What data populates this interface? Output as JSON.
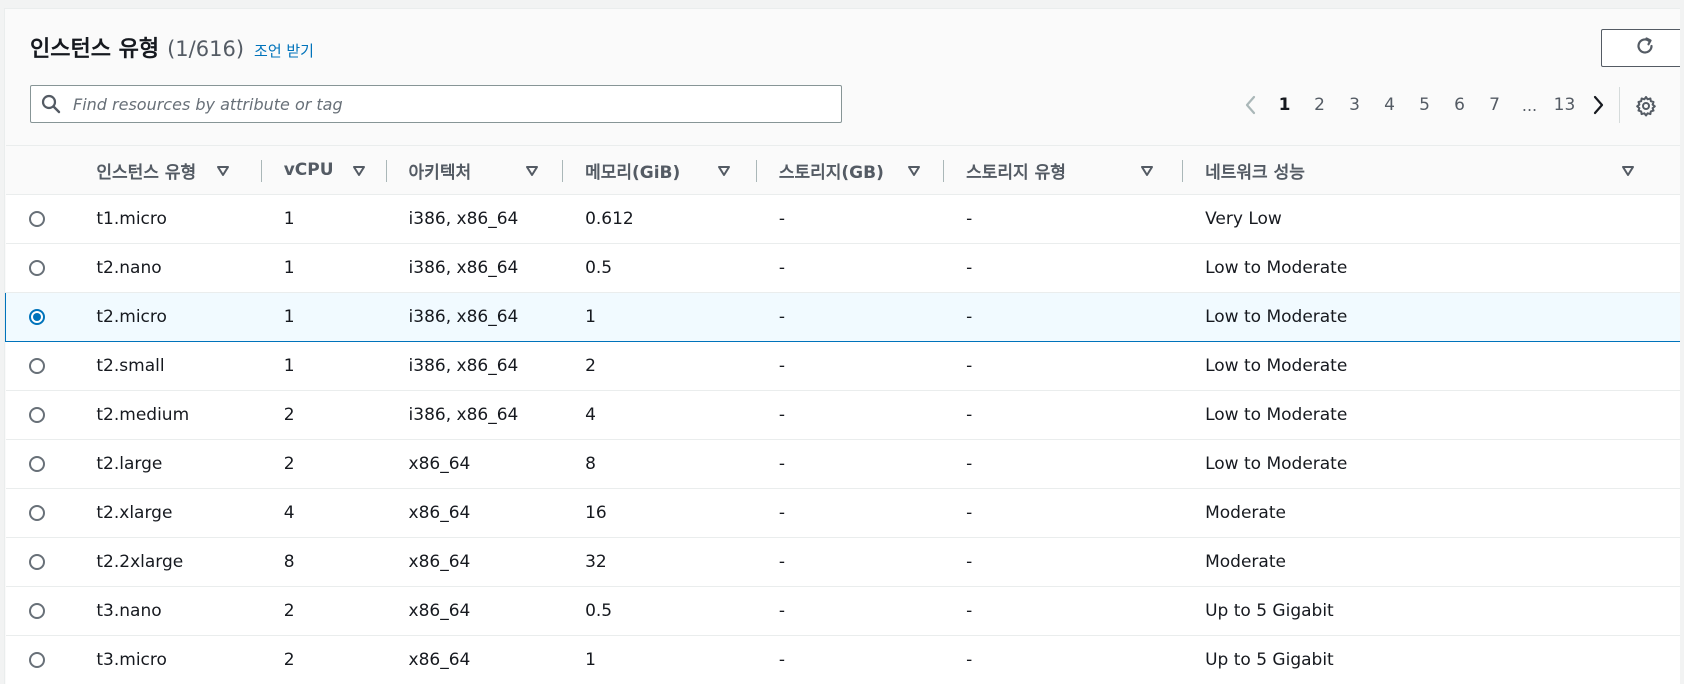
{
  "header": {
    "title": "인스턴스 유형",
    "count": "(1/616)",
    "info_link": "조언 받기"
  },
  "search": {
    "placeholder": "Find resources by attribute or tag"
  },
  "pagination": {
    "pages": [
      "1",
      "2",
      "3",
      "4",
      "5",
      "6",
      "7"
    ],
    "ellipsis": "...",
    "last_page": "13",
    "current": "1"
  },
  "columns": [
    "인스턴스 유형",
    "vCPU",
    "아키텍처",
    "메모리(GiB)",
    "스토리지(GB)",
    "스토리지 유형",
    "네트워크 성능"
  ],
  "rows": [
    {
      "type": "t1.micro",
      "vcpu": "1",
      "arch": "i386, x86_64",
      "memory": "0.612",
      "storage": "-",
      "storage_type": "-",
      "network": "Very Low",
      "selected": false
    },
    {
      "type": "t2.nano",
      "vcpu": "1",
      "arch": "i386, x86_64",
      "memory": "0.5",
      "storage": "-",
      "storage_type": "-",
      "network": "Low to Moderate",
      "selected": false
    },
    {
      "type": "t2.micro",
      "vcpu": "1",
      "arch": "i386, x86_64",
      "memory": "1",
      "storage": "-",
      "storage_type": "-",
      "network": "Low to Moderate",
      "selected": true
    },
    {
      "type": "t2.small",
      "vcpu": "1",
      "arch": "i386, x86_64",
      "memory": "2",
      "storage": "-",
      "storage_type": "-",
      "network": "Low to Moderate",
      "selected": false
    },
    {
      "type": "t2.medium",
      "vcpu": "2",
      "arch": "i386, x86_64",
      "memory": "4",
      "storage": "-",
      "storage_type": "-",
      "network": "Low to Moderate",
      "selected": false
    },
    {
      "type": "t2.large",
      "vcpu": "2",
      "arch": "x86_64",
      "memory": "8",
      "storage": "-",
      "storage_type": "-",
      "network": "Low to Moderate",
      "selected": false
    },
    {
      "type": "t2.xlarge",
      "vcpu": "4",
      "arch": "x86_64",
      "memory": "16",
      "storage": "-",
      "storage_type": "-",
      "network": "Moderate",
      "selected": false
    },
    {
      "type": "t2.2xlarge",
      "vcpu": "8",
      "arch": "x86_64",
      "memory": "32",
      "storage": "-",
      "storage_type": "-",
      "network": "Moderate",
      "selected": false
    },
    {
      "type": "t3.nano",
      "vcpu": "2",
      "arch": "x86_64",
      "memory": "0.5",
      "storage": "-",
      "storage_type": "-",
      "network": "Up to 5 Gigabit",
      "selected": false
    },
    {
      "type": "t3.micro",
      "vcpu": "2",
      "arch": "x86_64",
      "memory": "1",
      "storage": "-",
      "storage_type": "-",
      "network": "Up to 5 Gigabit",
      "selected": false
    }
  ],
  "colors": {
    "accent": "#0073bb",
    "selected_row_bg": "#f1faff",
    "header_text": "#545b64"
  },
  "icons": {
    "search": "search-icon",
    "refresh": "refresh-icon",
    "prev": "chevron-left-icon",
    "next": "chevron-right-icon",
    "settings": "gear-icon",
    "sort": "sort-down-icon"
  }
}
